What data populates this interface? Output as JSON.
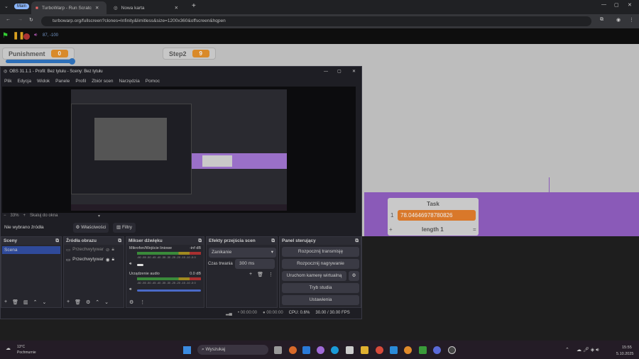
{
  "browser": {
    "profile": "Main",
    "tabs": [
      {
        "title": "TurboWarp - Run Scratch proje",
        "icon": "turbowarp-icon"
      },
      {
        "title": "Nowa karta",
        "icon": "chrome-icon"
      }
    ],
    "url": "turbowarp.org/fullscreen?clones=Infinity&limitless&size=1200x360&offscreen&hqpen"
  },
  "turbowarp": {
    "fps_readout": "87, -100"
  },
  "monitors": {
    "punishment": {
      "label": "Punishment",
      "value": "0",
      "slider_fraction": 1.0
    },
    "step2": {
      "label": "Step2",
      "value": "9"
    }
  },
  "list": {
    "title": "Task",
    "items": [
      {
        "index": "1",
        "value": "78.04646978780826"
      }
    ],
    "add": "+",
    "length": "length 1",
    "resize": "="
  },
  "obs": {
    "title": "OBS 31.1.1 - Profil: Bez tytułu - Sceny: Bez tytułu",
    "menu": [
      "Plik",
      "Edycja",
      "Widok",
      "Panele",
      "Profil",
      "Zbiór scen",
      "Narzędzia",
      "Pomoc"
    ],
    "zoom": "33%",
    "zoom_mode": "Skaluj do okna",
    "no_source": "Nie wybrano źródła",
    "properties": "Właściwości",
    "filters": "Filtry",
    "scenes": {
      "title": "Sceny",
      "items": [
        "Scena"
      ]
    },
    "sources": {
      "title": "Źródła obrazu",
      "items": [
        "Przechwytywar",
        "Przechwytywar"
      ]
    },
    "mixer": {
      "title": "Mikser dźwięku",
      "channels": [
        {
          "name": "Mikrofon/Wejście liniowe",
          "level": "-inf dB",
          "volume": 0.1
        },
        {
          "name": "Urządzenie audio",
          "level": "0.0 dB",
          "volume": 1.0
        }
      ],
      "scale": "-60 -55 -50 -45 -40 -35 -30 -25 -20 -15 -10 -5 0"
    },
    "transitions": {
      "title": "Efekty przejścia scen",
      "selected": "Zanikanie",
      "duration_label": "Czas trwania",
      "duration": "300 ms"
    },
    "controls": {
      "title": "Panel sterujący",
      "buttons": [
        "Rozpocznij transmisję",
        "Rozpocznij nagrywanie",
        "Uruchom kamerę wirtualną",
        "Tryb studia",
        "Ustawienia"
      ]
    },
    "status": {
      "stream_time": "00:00:00",
      "rec_time": "00:00:00",
      "cpu": "CPU: 0.6%",
      "fps": "30.00 / 30.00 FPS"
    }
  },
  "taskbar": {
    "weather_temp": "13°C",
    "weather_desc": "Pochmurnie",
    "search": "Wyszukaj",
    "time": "15:55",
    "date": "5.10.2025"
  }
}
